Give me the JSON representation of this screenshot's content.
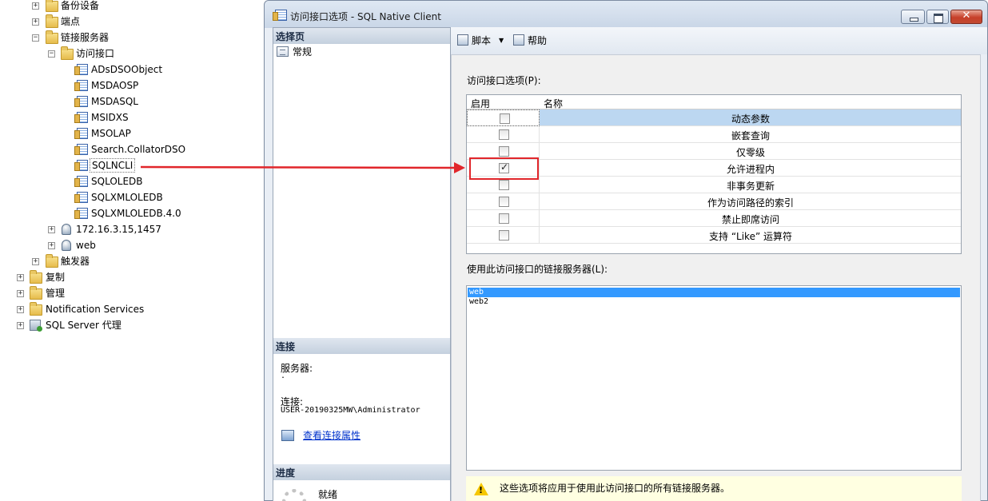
{
  "tree": {
    "nodes": [
      {
        "label": "备份设备",
        "icon": "folder-icon",
        "expander": "+"
      },
      {
        "label": "端点",
        "icon": "folder-icon",
        "expander": "+"
      },
      {
        "label": "链接服务器",
        "icon": "folder-icon",
        "expander": "−"
      },
      {
        "label": "访问接口",
        "icon": "folder-icon",
        "expander": "−"
      },
      {
        "label": "ADsDSOObject",
        "icon": "provider-icon"
      },
      {
        "label": "MSDAOSP",
        "icon": "provider-icon"
      },
      {
        "label": "MSDASQL",
        "icon": "provider-icon"
      },
      {
        "label": "MSIDXS",
        "icon": "provider-icon"
      },
      {
        "label": "MSOLAP",
        "icon": "provider-icon"
      },
      {
        "label": "Search.CollatorDSO",
        "icon": "provider-icon"
      },
      {
        "label": "SQLNCLI",
        "icon": "provider-icon"
      },
      {
        "label": "SQLOLEDB",
        "icon": "provider-icon"
      },
      {
        "label": "SQLXMLOLEDB",
        "icon": "provider-icon"
      },
      {
        "label": "SQLXMLOLEDB.4.0",
        "icon": "provider-icon"
      },
      {
        "label": "172.16.3.15,1457",
        "icon": "linked-server-icon",
        "expander": "+"
      },
      {
        "label": "web",
        "icon": "linked-server-icon",
        "expander": "+"
      },
      {
        "label": "触发器",
        "icon": "folder-icon",
        "expander": "+"
      },
      {
        "label": "复制",
        "icon": "folder-icon",
        "expander": "+"
      },
      {
        "label": "管理",
        "icon": "folder-icon",
        "expander": "+"
      },
      {
        "label": "Notification Services",
        "icon": "folder-icon",
        "expander": "+"
      },
      {
        "label": "SQL Server 代理",
        "icon": "sql-agent-icon",
        "expander": "+"
      }
    ]
  },
  "dialog": {
    "title": "访问接口选项 - SQL Native Client",
    "close_glyph": "✕",
    "select_page": {
      "header": "选择页",
      "items": [
        "常规"
      ]
    },
    "connection": {
      "header": "连接",
      "server_label": "服务器:",
      "server_value": ".",
      "conn_label": "连接:",
      "conn_value": "USER-20190325MW\\Administrator",
      "view_link": "查看连接属性"
    },
    "progress": {
      "header": "进度",
      "status": "就绪"
    },
    "toolbar": {
      "script_label": "脚本",
      "help_label": "帮助",
      "dropdown_glyph": "▼"
    },
    "options": {
      "label": "访问接口选项(P):",
      "col_enabled": "启用",
      "col_name": "名称",
      "rows": [
        {
          "name": "动态参数",
          "checked": false
        },
        {
          "name": "嵌套查询",
          "checked": false
        },
        {
          "name": "仅零级",
          "checked": false
        },
        {
          "name": "允许进程内",
          "checked": true
        },
        {
          "name": "非事务更新",
          "checked": false
        },
        {
          "name": "作为访问路径的索引",
          "checked": false
        },
        {
          "name": "禁止即席访问",
          "checked": false
        },
        {
          "name": "支持 “Like” 运算符",
          "checked": false
        }
      ]
    },
    "linked_servers": {
      "label": "使用此访问接口的链接服务器(L):",
      "items": [
        "web",
        "web2"
      ]
    },
    "notice": {
      "text": "这些选项将应用于使用此访问接口的所有链接服务器。",
      "icon": "warning-icon",
      "icon_glyph": "!"
    }
  },
  "colors": {
    "arrow": "#e1262b",
    "selection": "#3399ff",
    "row_highlight": "#bcd7f1"
  }
}
